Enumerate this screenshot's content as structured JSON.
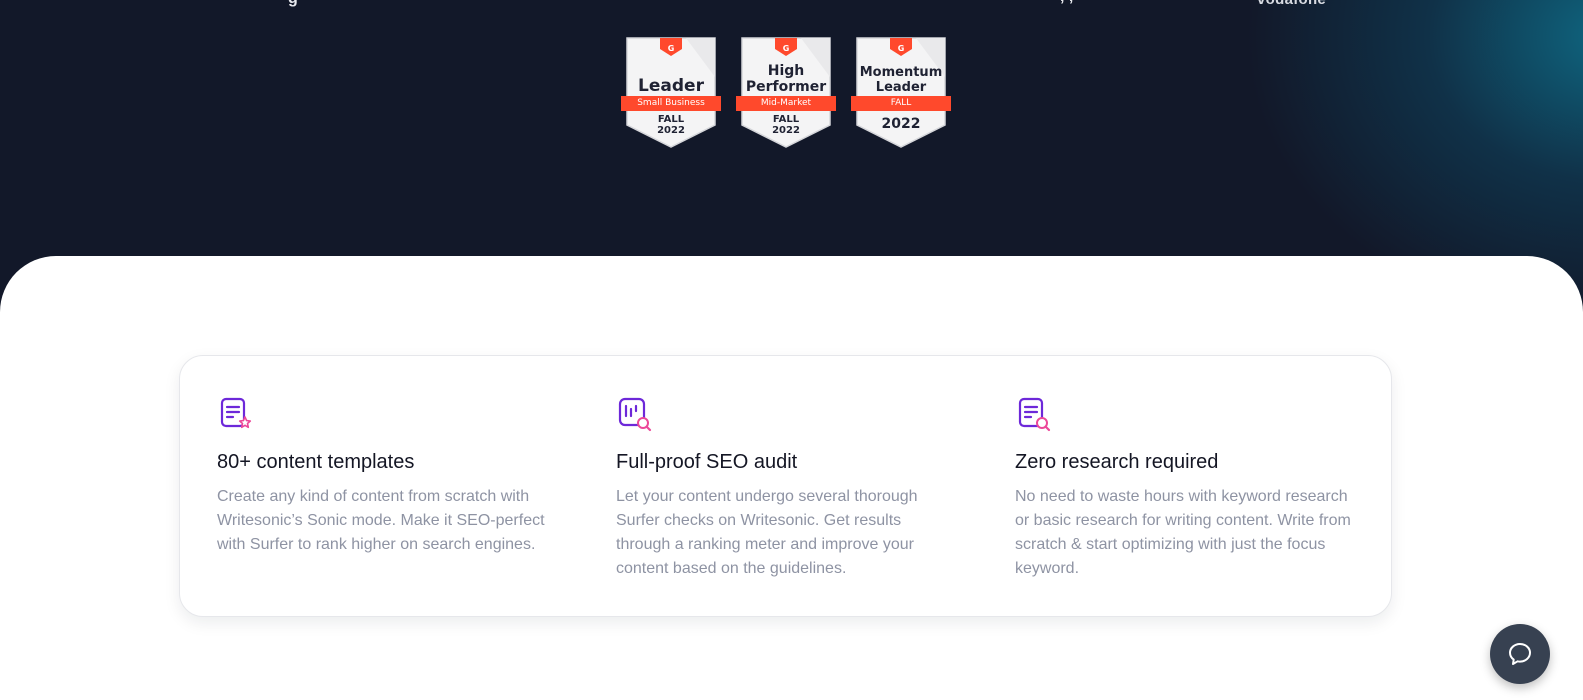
{
  "hero": {
    "partner_logo": "vodafone"
  },
  "badges": [
    {
      "platform": "G2",
      "title_lines": [
        "Leader"
      ],
      "ribbon": "Small Business",
      "season": "FALL",
      "year": "2022"
    },
    {
      "platform": "G2",
      "title_lines": [
        "High",
        "Performer"
      ],
      "ribbon": "Mid-Market",
      "season": "FALL",
      "year": "2022"
    },
    {
      "platform": "G2",
      "title_lines": [
        "Momentum",
        "Leader"
      ],
      "ribbon": "FALL",
      "season": "",
      "year": "2022"
    }
  ],
  "features": [
    {
      "icon": "document-star-icon",
      "title": "80+ content templates",
      "description": "Create any kind of content from scratch with Writesonic’s Sonic mode. Make it SEO-perfect with Surfer to rank higher on search engines."
    },
    {
      "icon": "chart-search-icon",
      "title": "Full-proof SEO audit",
      "description": "Let your content undergo several thorough Surfer checks on Writesonic. Get results through a ranking meter and improve your content based on the guidelines."
    },
    {
      "icon": "document-search-icon",
      "title": "Zero research required",
      "description": "No need to waste hours with keyword research or basic research for writing content. Write from scratch & start optimizing with just the focus keyword."
    }
  ],
  "colors": {
    "hero_background": "#121829",
    "ribbon": "#ff492c",
    "icon_primary": "#6d28d9",
    "icon_accent": "#ec4899",
    "chat_button": "#374151"
  },
  "chat": {
    "icon": "chat-bubble-icon"
  }
}
